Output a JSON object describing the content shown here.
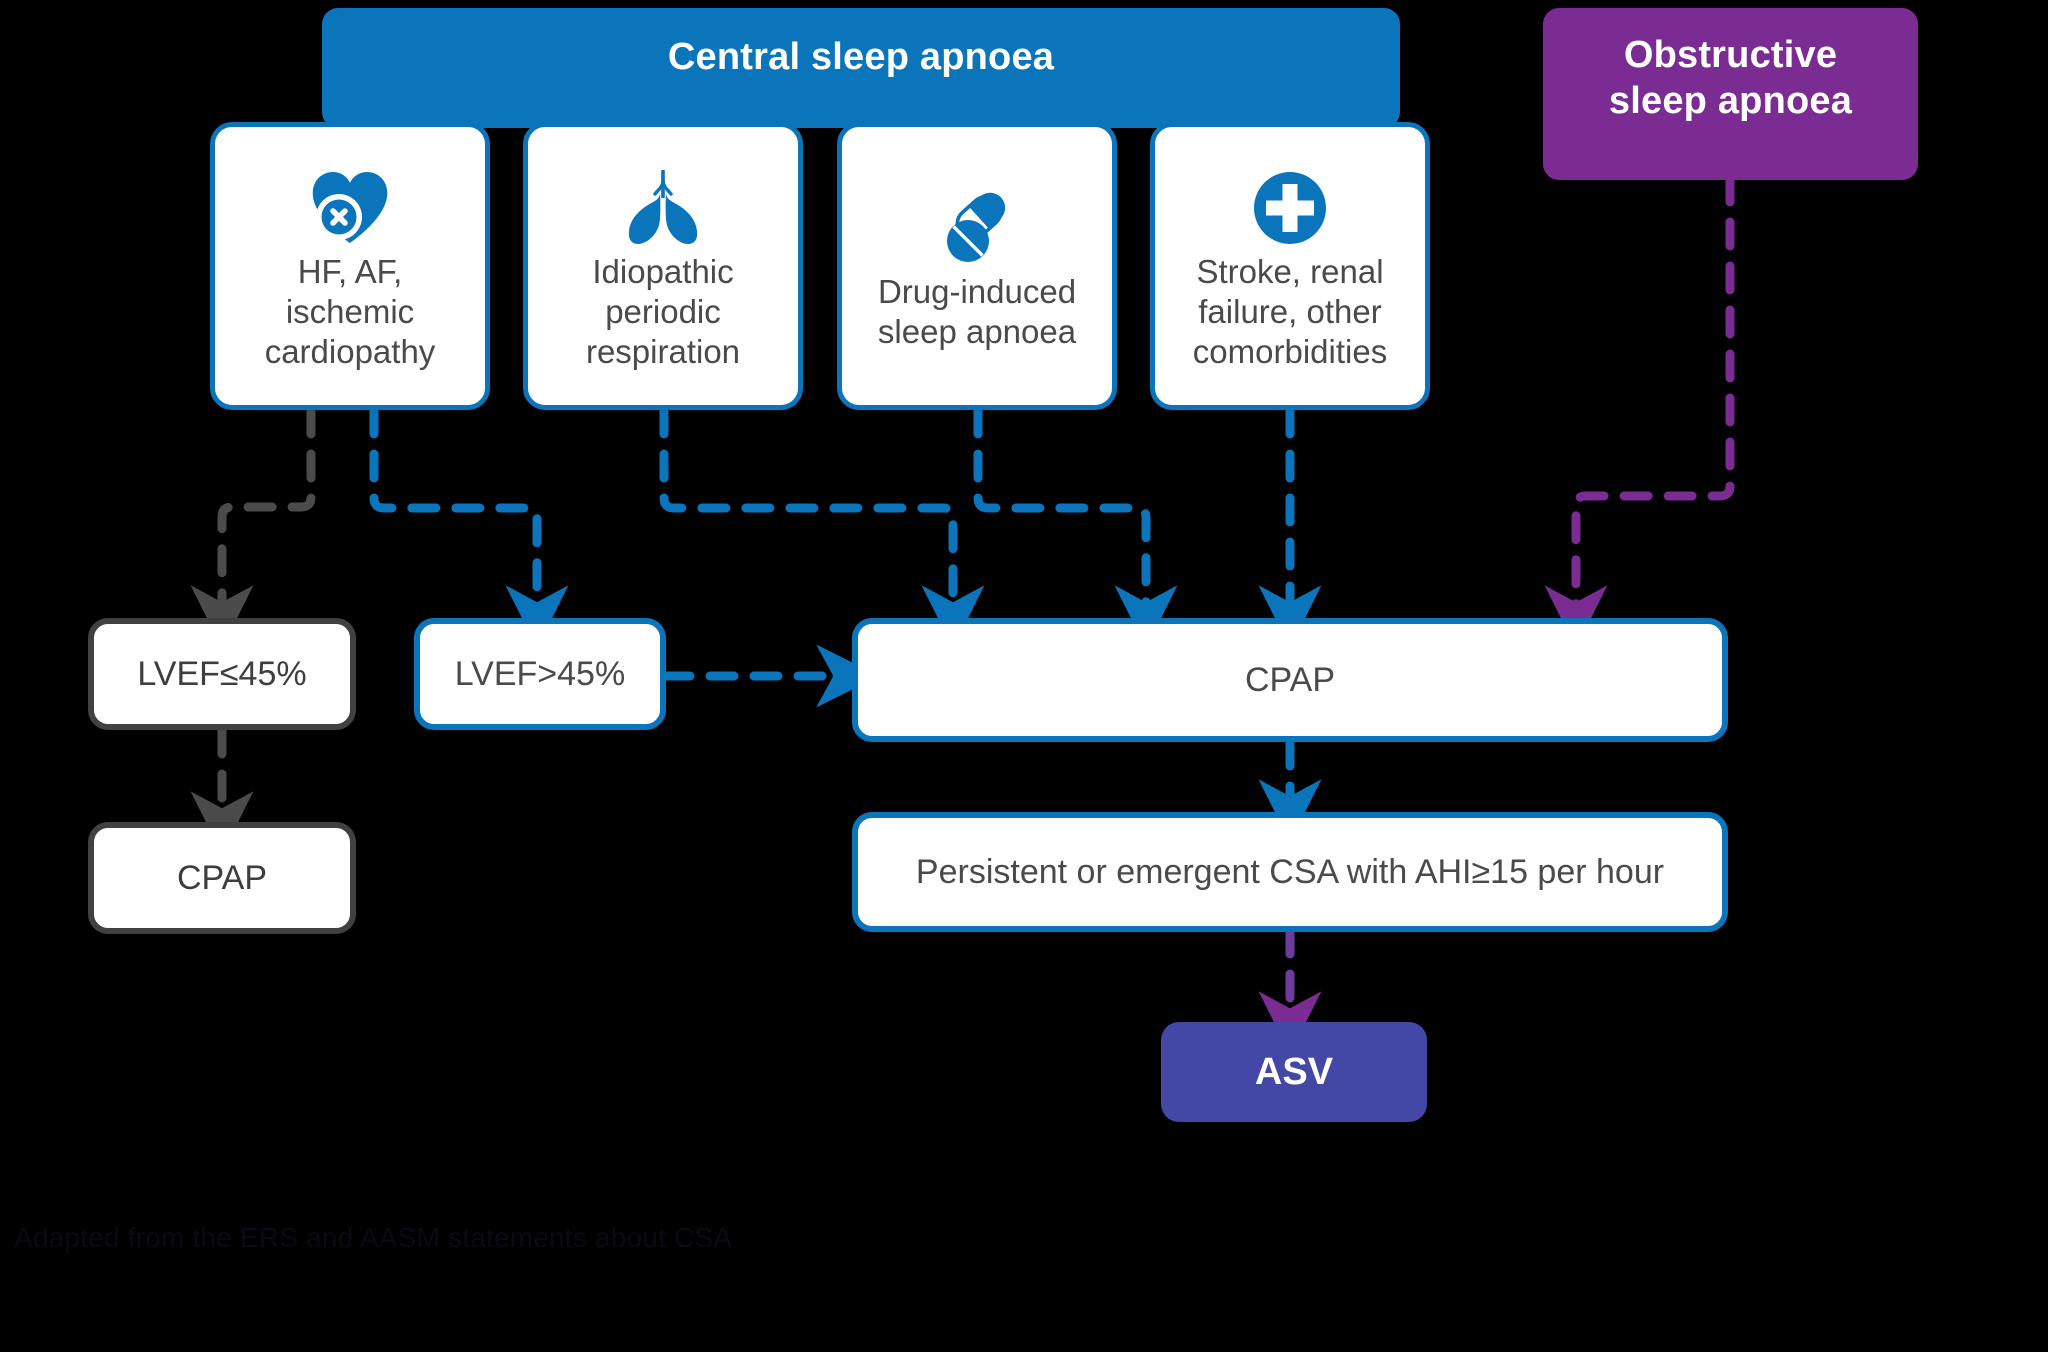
{
  "headers": {
    "central": "Central sleep apnoea",
    "obstructive": "Obstructive\nsleep apnoea"
  },
  "cards": [
    {
      "icon": "broken-heart-icon",
      "label": "HF, AF,\nischemic\ncardiopathy"
    },
    {
      "icon": "lungs-icon",
      "label": "Idiopathic\nperiodic\nrespiration"
    },
    {
      "icon": "pills-icon",
      "label": "Drug-induced\nsleep apnoea"
    },
    {
      "icon": "medical-cross-icon",
      "label": "Stroke, renal\nfailure, other\ncomorbidities"
    }
  ],
  "decisions": {
    "lvef_low": "LVEF≤45%",
    "lvef_high": "LVEF>45%"
  },
  "treatments": {
    "cpap_left": "CPAP",
    "cpap_main": "CPAP",
    "persistent": "Persistent or emergent CSA with AHI≥15 per hour",
    "asv": "ASV"
  },
  "caption": "Adapted from the ERS and AASM statements about CSA",
  "colors": {
    "blue": "#0B75BC",
    "purple": "#7A2C92",
    "indigo": "#4347A6",
    "grey": "#414141",
    "text": "#4A4A4A",
    "background": "#000000"
  }
}
